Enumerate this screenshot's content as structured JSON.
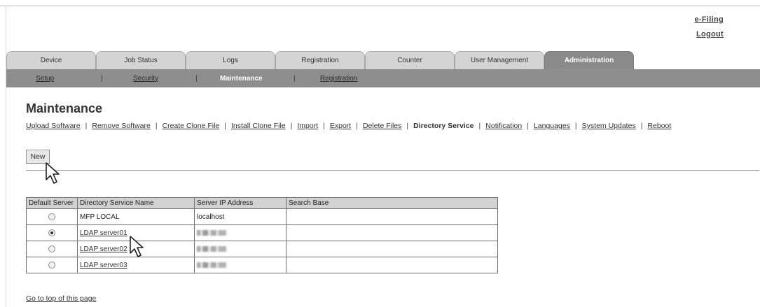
{
  "header": {
    "links": [
      "e-Filing",
      "Logout"
    ]
  },
  "tabs": [
    {
      "label": "Device",
      "active": false
    },
    {
      "label": "Job Status",
      "active": false
    },
    {
      "label": "Logs",
      "active": false
    },
    {
      "label": "Registration",
      "active": false
    },
    {
      "label": "Counter",
      "active": false
    },
    {
      "label": "User Management",
      "active": false
    },
    {
      "label": "Administration",
      "active": true
    }
  ],
  "subnav": [
    {
      "label": "Setup",
      "active": false
    },
    {
      "label": "Security",
      "active": false
    },
    {
      "label": "Maintenance",
      "active": true
    },
    {
      "label": "Registration",
      "active": false
    }
  ],
  "page": {
    "title": "Maintenance",
    "links": [
      {
        "label": "Upload Software",
        "current": false
      },
      {
        "label": "Remove Software",
        "current": false
      },
      {
        "label": "Create Clone File ",
        "current": false
      },
      {
        "label": "Install Clone File ",
        "current": false
      },
      {
        "label": "Import",
        "current": false
      },
      {
        "label": "Export",
        "current": false
      },
      {
        "label": "Delete Files",
        "current": false
      },
      {
        "label": "Directory Service",
        "current": true
      },
      {
        "label": "Notification",
        "current": false
      },
      {
        "label": "Languages",
        "current": false
      },
      {
        "label": "System Updates",
        "current": false
      },
      {
        "label": "Reboot",
        "current": false
      }
    ],
    "new_button": "New",
    "go_top": "Go to top of this page"
  },
  "table": {
    "headers": [
      "Default Server",
      "Directory Service Name",
      "Server IP Address",
      "Search Base"
    ],
    "rows": [
      {
        "default": false,
        "name": "MFP LOCAL",
        "name_link": false,
        "ip": "localhost",
        "ip_obscured": false,
        "search_base": ""
      },
      {
        "default": true,
        "name": "LDAP server01",
        "name_link": true,
        "ip": "",
        "ip_obscured": true,
        "search_base": ""
      },
      {
        "default": false,
        "name": "LDAP server02",
        "name_link": true,
        "ip": "",
        "ip_obscured": true,
        "search_base": ""
      },
      {
        "default": false,
        "name": "LDAP server03",
        "name_link": true,
        "ip": "",
        "ip_obscured": true,
        "search_base": ""
      }
    ]
  },
  "icons": {
    "cursor": "arrow-cursor-icon",
    "radio": "radio-button-icon"
  }
}
